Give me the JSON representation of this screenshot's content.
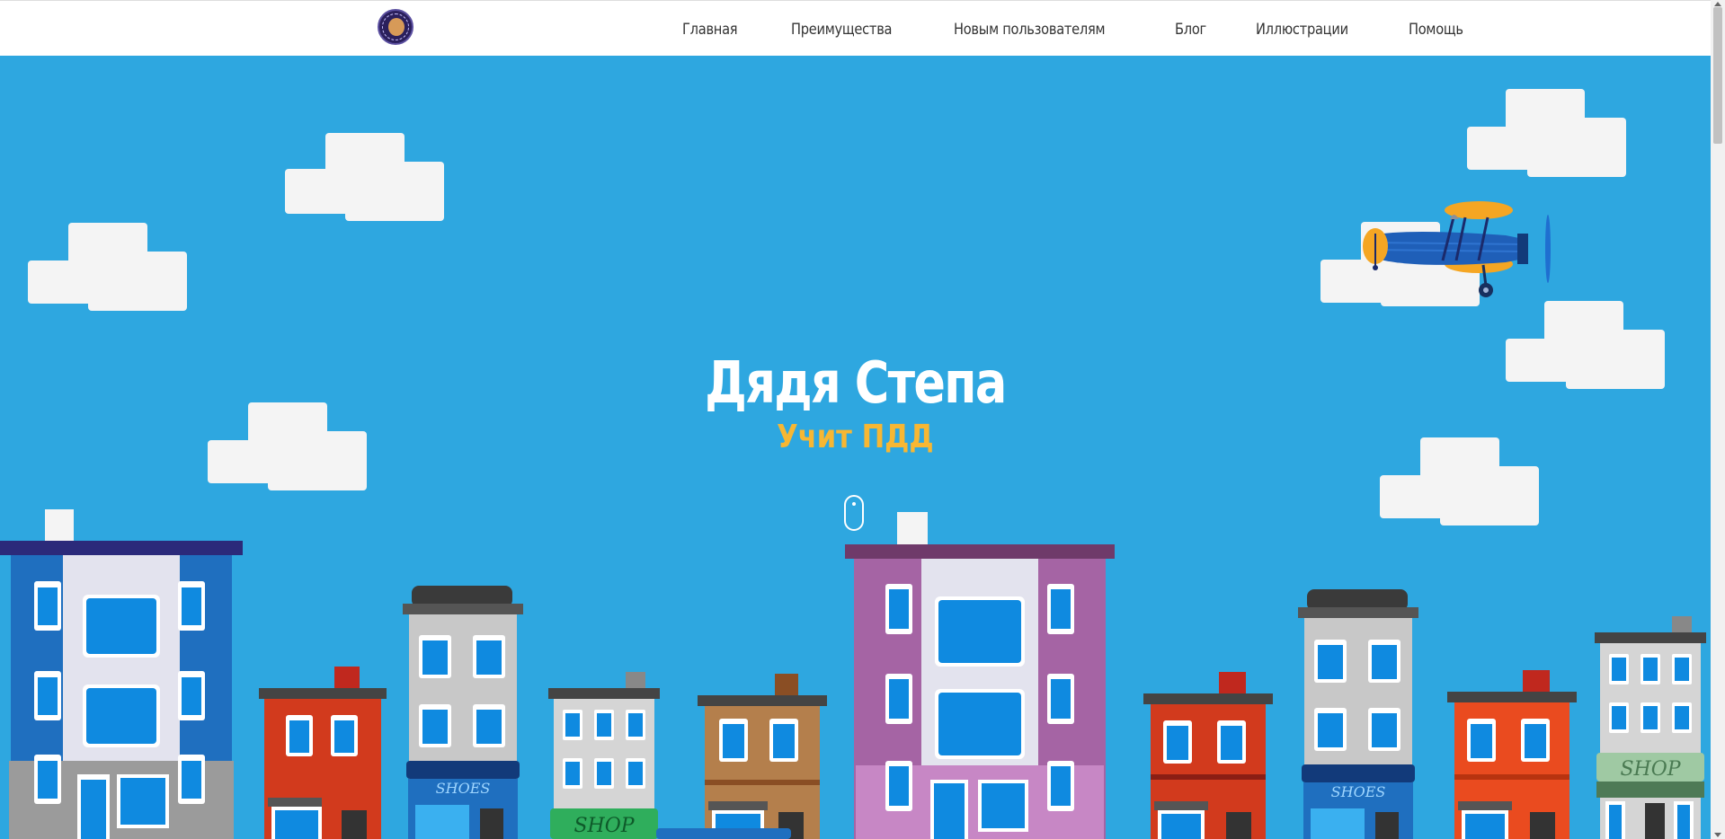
{
  "nav": {
    "logo_alt": "Дядя Степа учит ПДД",
    "items": [
      {
        "label": "Главная"
      },
      {
        "label": "Преимущества"
      },
      {
        "label": "Новым пользователям"
      },
      {
        "label": "Блог"
      },
      {
        "label": "Иллюстрации"
      },
      {
        "label": "Помощь"
      }
    ]
  },
  "hero": {
    "title": "Дядя Степа",
    "subtitle": "Учит ПДД",
    "shop_signs": [
      "SHOP",
      "SHOP"
    ],
    "shoe_signs": [
      "SHOES",
      "SHOES"
    ]
  },
  "colors": {
    "sky": "#2ea7e0",
    "cloud": "#f4f4f4",
    "subtitle": "#f7b733",
    "title": "#ffffff"
  }
}
